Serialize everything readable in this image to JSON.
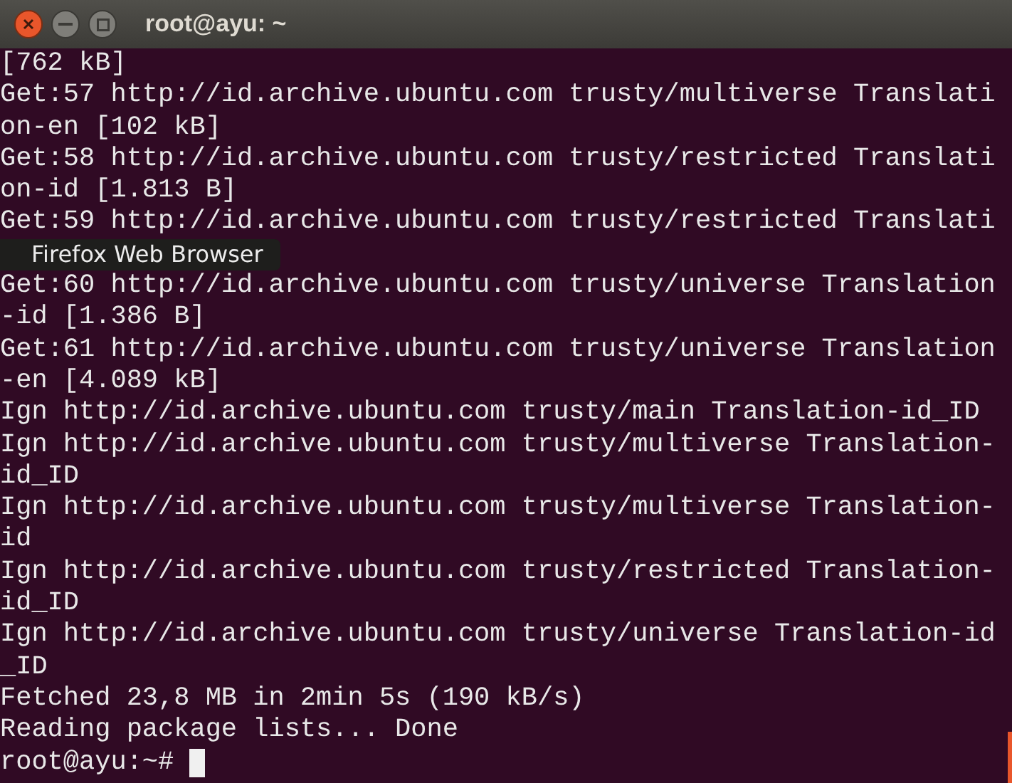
{
  "window": {
    "title": "root@ayu: ~"
  },
  "terminal": {
    "lines_above": [
      "[762 kB]",
      "Get:57 http://id.archive.ubuntu.com trusty/multiverse Translati",
      "on-en [102 kB]",
      "Get:58 http://id.archive.ubuntu.com trusty/restricted Translati",
      "on-id [1.813 B]",
      "Get:59 http://id.archive.ubuntu.com trusty/restricted Translati"
    ],
    "tooltip": "Firefox Web Browser",
    "lines_below": [
      "Get:60 http://id.archive.ubuntu.com trusty/universe Translation",
      "-id [1.386 B]",
      "Get:61 http://id.archive.ubuntu.com trusty/universe Translation",
      "-en [4.089 kB]",
      "Ign http://id.archive.ubuntu.com trusty/main Translation-id_ID",
      "Ign http://id.archive.ubuntu.com trusty/multiverse Translation-",
      "id_ID",
      "Ign http://id.archive.ubuntu.com trusty/multiverse Translation-",
      "id",
      "Ign http://id.archive.ubuntu.com trusty/restricted Translation-",
      "id_ID",
      "Ign http://id.archive.ubuntu.com trusty/universe Translation-id",
      "_ID",
      "Fetched 23,8 MB in 2min 5s (190 kB/s)",
      "Reading package lists... Done"
    ],
    "prompt": "root@ayu:~#"
  }
}
